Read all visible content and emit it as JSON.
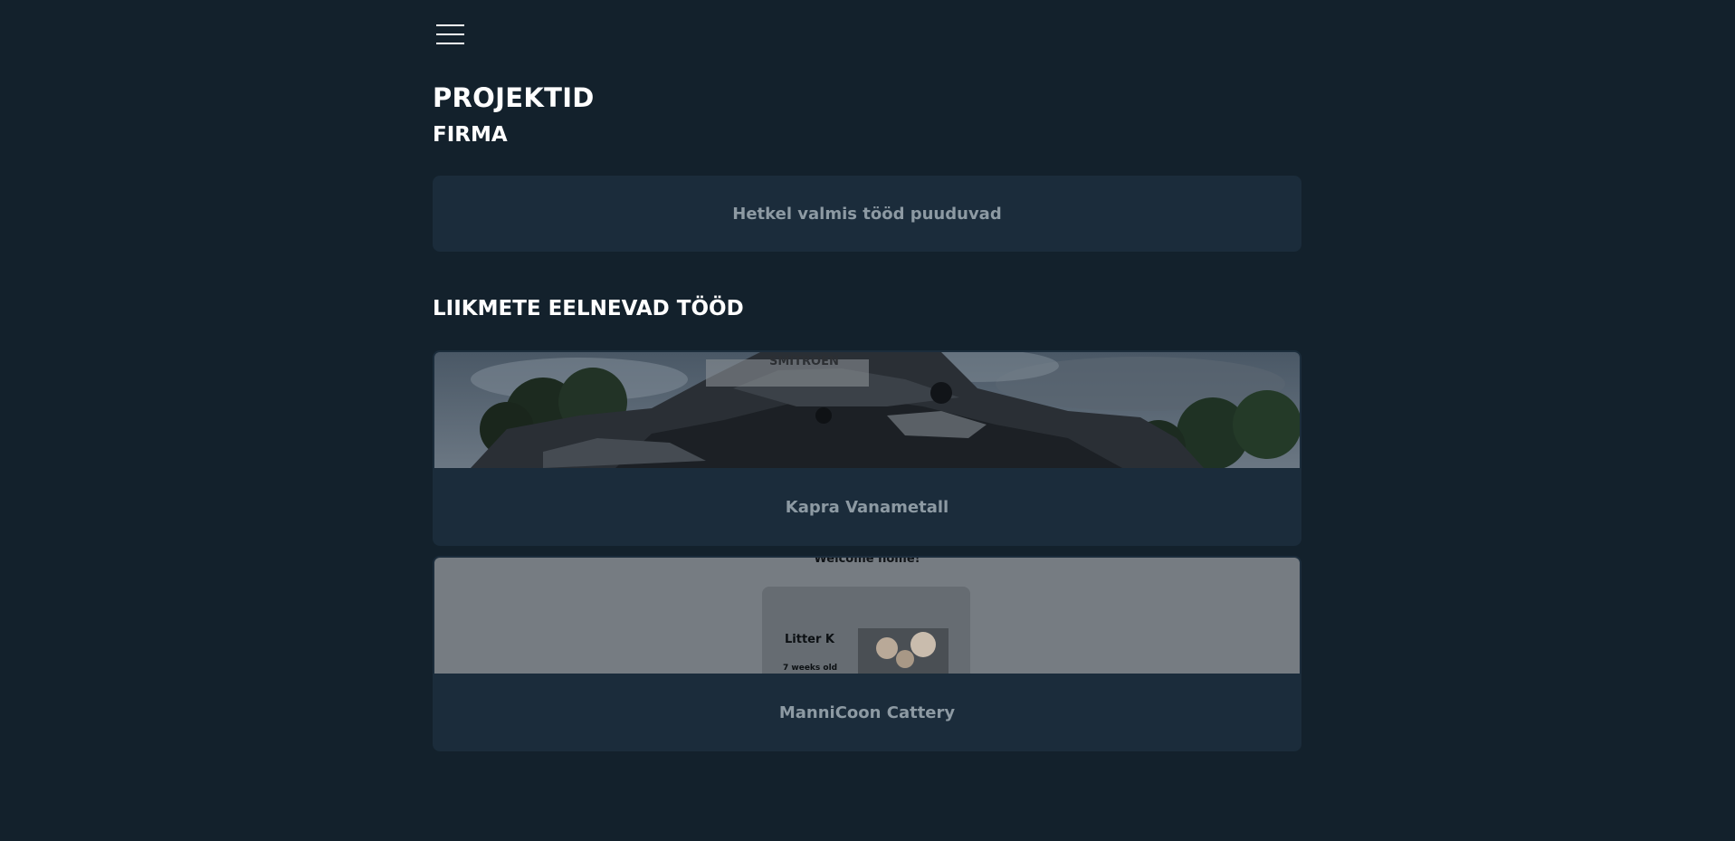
{
  "header": {
    "menu_icon": "hamburger-menu-icon"
  },
  "page": {
    "title": "PROJEKTID",
    "subtitle": "FIRMA",
    "empty_message": "Hetkel valmis tööd puuduvad",
    "section_title": "LIIKMETE EELNEVAD TÖÖD"
  },
  "projects": [
    {
      "name": "Kapra Vanametall",
      "thumbnail_text": "SMITROEN"
    },
    {
      "name": "ManniCoon Cattery",
      "thumbnail": {
        "welcome": "Welcome home!",
        "litter_title": "Litter K",
        "litter_age": "7 weeks old"
      }
    }
  ],
  "colors": {
    "background": "#13212c",
    "card": "#1b2c3b",
    "muted_text": "#8d9aa3",
    "heading_text": "#ffffff"
  }
}
